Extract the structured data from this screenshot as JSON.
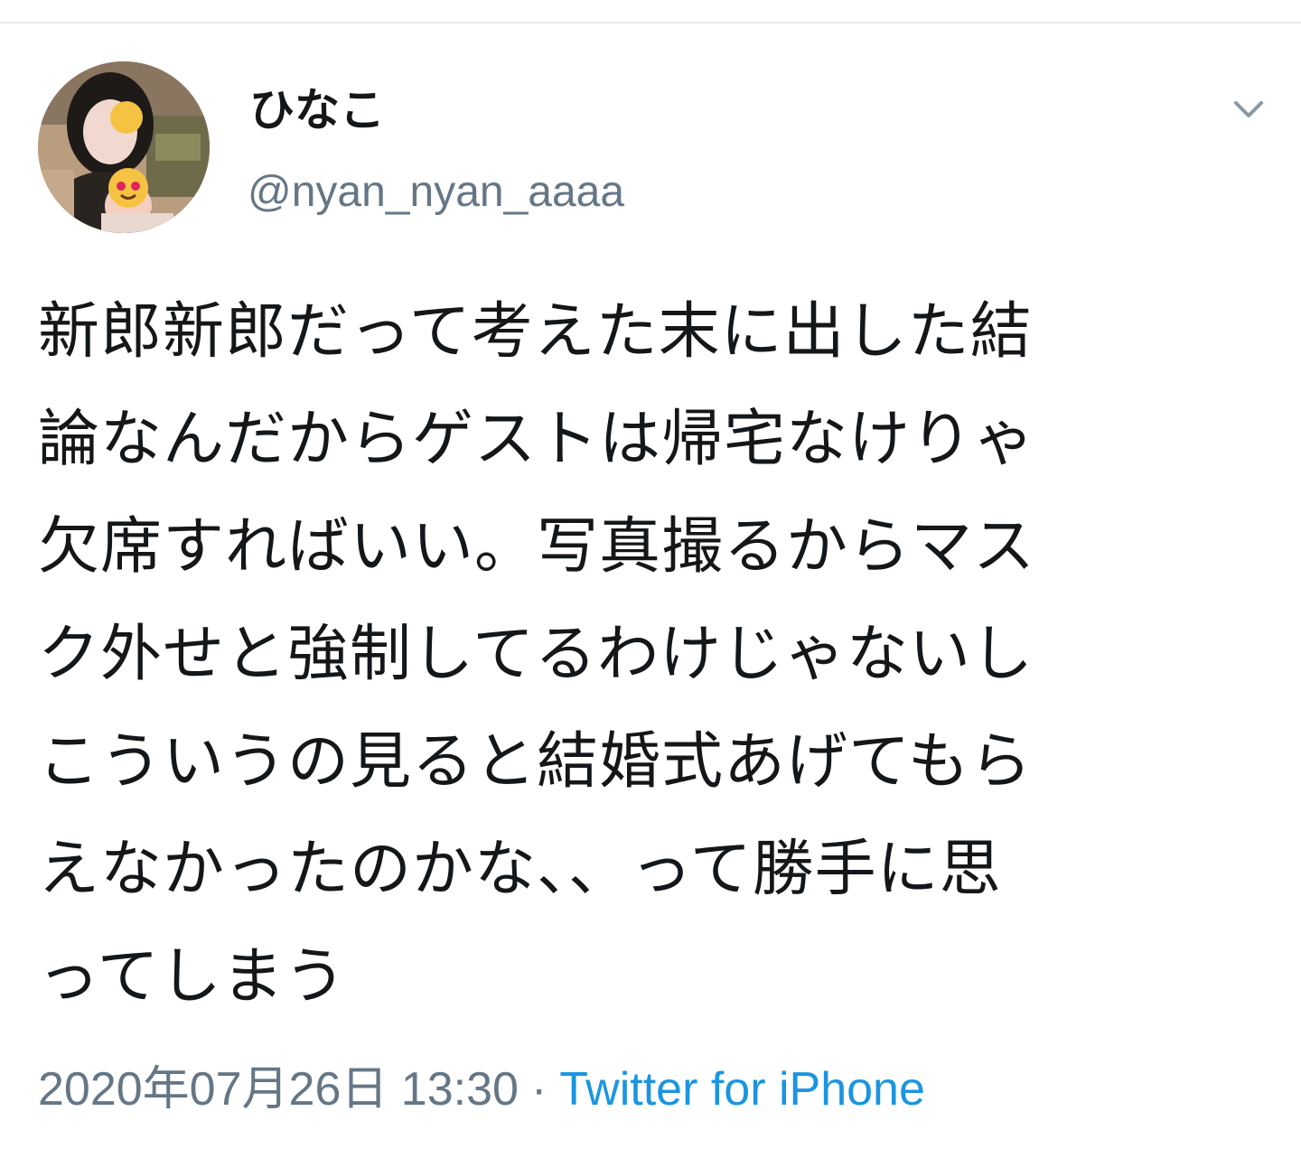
{
  "tweet": {
    "display_name": "ひなこ",
    "handle": "@nyan_nyan_aaaa",
    "text_lines": [
      "新郎新郎だって考えた末に出した結",
      "論なんだからゲストは帰宅なけりゃ",
      "欠席すればいい。写真撮るからマス",
      "ク外せと強制してるわけじゃないし",
      "こういうの見ると結婚式あげてもら",
      "えなかったのかな、、って勝手に思",
      "ってしまう"
    ],
    "timestamp": "2020年07月26日 13:30",
    "separator": "·",
    "source": "Twitter for iPhone"
  },
  "icons": {
    "avatar": "avatar-photo",
    "menu": "chevron-down-icon"
  },
  "colors": {
    "primary_text": "#14171a",
    "secondary_text": "#657786",
    "link": "#1b95e0",
    "divider": "#e6ecf0"
  }
}
